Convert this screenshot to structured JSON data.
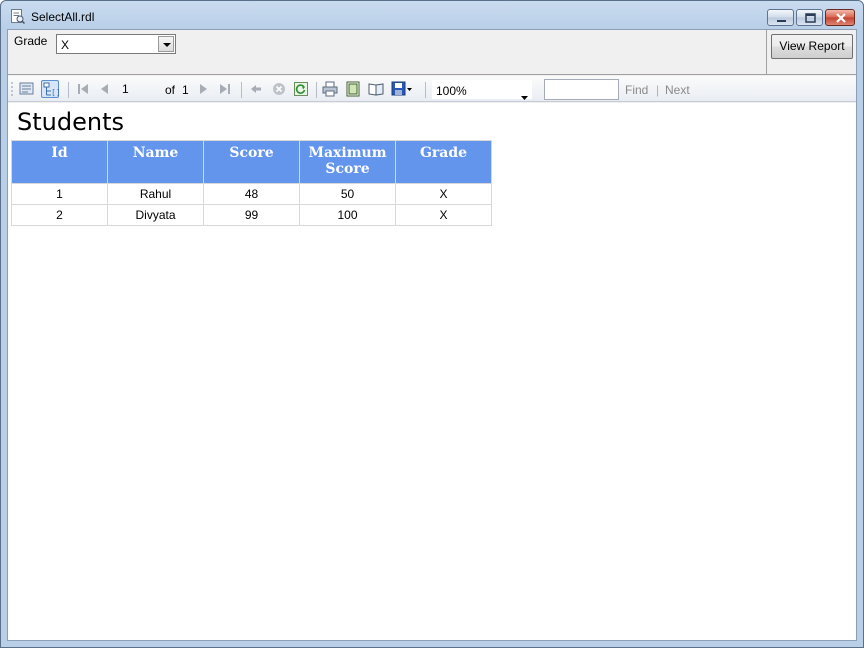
{
  "window": {
    "title": "SelectAll.rdl",
    "icon": "report-file-icon"
  },
  "parameters": {
    "grade_label": "Grade",
    "grade_value": "X",
    "view_report_label": "View Report"
  },
  "toolbar": {
    "page_current": "1",
    "page_of": "of",
    "page_total": "1",
    "zoom": "100%",
    "find_placeholder": "",
    "find_label": "Find",
    "separator": "|",
    "next_label": "Next"
  },
  "report": {
    "title": "Students",
    "columns": [
      "Id",
      "Name",
      "Score",
      "Maximum Score",
      "Grade"
    ],
    "rows": [
      [
        "1",
        "Rahul",
        "48",
        "50",
        "X"
      ],
      [
        "2",
        "Divyata",
        "99",
        "100",
        "X"
      ]
    ]
  },
  "colors": {
    "header_bg": "#6495ed",
    "header_text": "#ffffff"
  }
}
